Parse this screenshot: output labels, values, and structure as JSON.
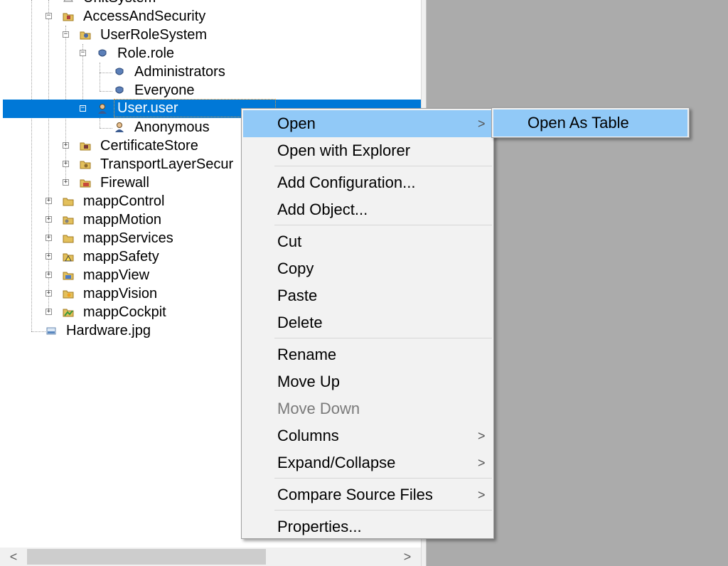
{
  "tree": {
    "items": [
      {
        "label": "UnitSystem",
        "icon": "unit-system-icon"
      },
      {
        "label": "AccessAndSecurity",
        "icon": "access-security-folder-icon",
        "expander": "−"
      },
      {
        "label": "UserRoleSystem",
        "icon": "user-role-system-icon",
        "expander": "−"
      },
      {
        "label": "Role.role",
        "icon": "role-file-icon",
        "expander": "−"
      },
      {
        "label": "Administrators",
        "icon": "role-icon"
      },
      {
        "label": "Everyone",
        "icon": "role-icon"
      },
      {
        "label": "User.user",
        "icon": "user-file-icon",
        "expander": "−",
        "selected": true
      },
      {
        "label": "Anonymous",
        "icon": "user-icon"
      },
      {
        "label": "CertificateStore",
        "icon": "certificate-store-icon",
        "expander": "+"
      },
      {
        "label": "TransportLayerSecur",
        "icon": "transport-layer-security-icon",
        "expander": "+"
      },
      {
        "label": "Firewall",
        "icon": "firewall-icon",
        "expander": "+"
      },
      {
        "label": "mappControl",
        "icon": "folder-icon",
        "expander": "+"
      },
      {
        "label": "mappMotion",
        "icon": "mapp-motion-folder-icon",
        "expander": "+"
      },
      {
        "label": "mappServices",
        "icon": "folder-icon",
        "expander": "+"
      },
      {
        "label": "mappSafety",
        "icon": "mapp-safety-folder-icon",
        "expander": "+"
      },
      {
        "label": "mappView",
        "icon": "mapp-view-folder-icon",
        "expander": "+"
      },
      {
        "label": "mappVision",
        "icon": "mapp-vision-folder-icon",
        "expander": "+"
      },
      {
        "label": "mappCockpit",
        "icon": "mapp-cockpit-folder-icon",
        "expander": "+"
      },
      {
        "label": "Hardware.jpg",
        "icon": "image-file-icon"
      }
    ]
  },
  "scrollbar": {
    "left_arrow": "<",
    "right_arrow": ">"
  },
  "context_menu": {
    "items": [
      {
        "label": "Open",
        "submenu_arrow": ">"
      },
      {
        "label": "Open with Explorer"
      },
      {
        "label": "Add Configuration..."
      },
      {
        "label": "Add Object..."
      },
      {
        "label": "Cut"
      },
      {
        "label": "Copy"
      },
      {
        "label": "Paste"
      },
      {
        "label": "Delete"
      },
      {
        "label": "Rename"
      },
      {
        "label": "Move Up"
      },
      {
        "label": "Move Down",
        "disabled": true
      },
      {
        "label": "Columns",
        "submenu_arrow": ">"
      },
      {
        "label": "Expand/Collapse",
        "submenu_arrow": ">"
      },
      {
        "label": "Compare Source Files",
        "submenu_arrow": ">"
      },
      {
        "label": "Properties..."
      }
    ]
  },
  "submenu": {
    "items": [
      {
        "label": "Open As Table"
      }
    ]
  },
  "colors": {
    "selection": "#0078d7",
    "menu_highlight": "#91c9f7",
    "menu_background": "#f2f2f2",
    "workspace_background": "#ababab"
  }
}
